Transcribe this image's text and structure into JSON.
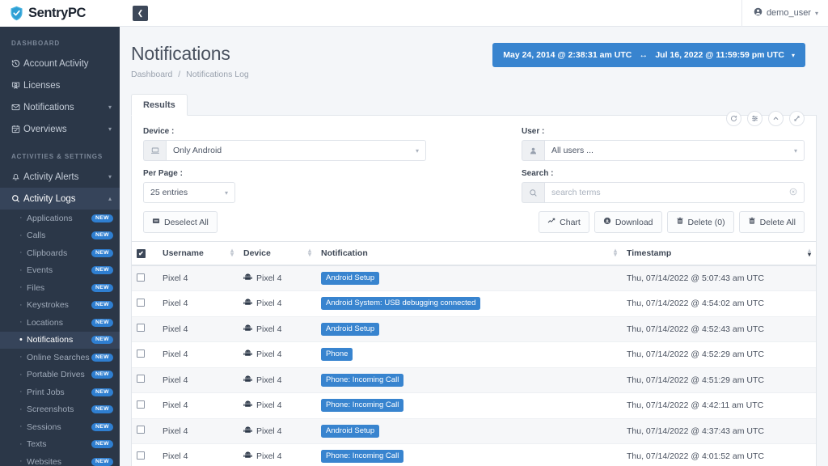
{
  "brand": {
    "name": "SentryPC",
    "logo_icon": "shield-check-icon"
  },
  "topbar": {
    "collapse_icon": "chevron-left-icon",
    "user_icon": "user-circle-icon",
    "username": "demo_user",
    "caret_icon": "chevron-down-icon"
  },
  "sidebar": {
    "sections": [
      {
        "label": "DASHBOARD",
        "items": [
          {
            "label": "Account Activity",
            "icon": "history-icon",
            "caret": false
          },
          {
            "label": "Licenses",
            "icon": "certificate-icon",
            "caret": false
          },
          {
            "label": "Notifications",
            "icon": "envelope-icon",
            "caret": true
          },
          {
            "label": "Overviews",
            "icon": "calendar-check-icon",
            "caret": true
          }
        ]
      },
      {
        "label": "ACTIVITIES & SETTINGS",
        "items": [
          {
            "label": "Activity Alerts",
            "icon": "bell-icon",
            "caret": true,
            "caret_dir": "down",
            "active": false
          },
          {
            "label": "Activity Logs",
            "icon": "search-icon",
            "caret": true,
            "caret_dir": "up",
            "active": true
          }
        ]
      }
    ],
    "sub_items": [
      {
        "label": "Applications",
        "badge": "NEW",
        "active": false
      },
      {
        "label": "Calls",
        "badge": "NEW",
        "active": false
      },
      {
        "label": "Clipboards",
        "badge": "NEW",
        "active": false
      },
      {
        "label": "Events",
        "badge": "NEW",
        "active": false
      },
      {
        "label": "Files",
        "badge": "NEW",
        "active": false
      },
      {
        "label": "Keystrokes",
        "badge": "NEW",
        "active": false
      },
      {
        "label": "Locations",
        "badge": "NEW",
        "active": false
      },
      {
        "label": "Notifications",
        "badge": "NEW",
        "active": true
      },
      {
        "label": "Online Searches",
        "badge": "NEW",
        "active": false
      },
      {
        "label": "Portable Drives",
        "badge": "NEW",
        "active": false
      },
      {
        "label": "Print Jobs",
        "badge": "NEW",
        "active": false
      },
      {
        "label": "Screenshots",
        "badge": "NEW",
        "active": false
      },
      {
        "label": "Sessions",
        "badge": "NEW",
        "active": false
      },
      {
        "label": "Texts",
        "badge": "NEW",
        "active": false
      },
      {
        "label": "Websites",
        "badge": "NEW",
        "active": false
      }
    ]
  },
  "page": {
    "title": "Notifications",
    "breadcrumb_root": "Dashboard",
    "breadcrumb_sep": "/",
    "breadcrumb_current": "Notifications Log",
    "date_range": {
      "start": "May 24, 2014 @ 2:38:31 am UTC",
      "arrows": "↔",
      "end": "Jul 16, 2022 @ 11:59:59 pm UTC",
      "caret_icon": "chevron-down-icon"
    }
  },
  "card": {
    "tab_label": "Results",
    "icon_buttons": [
      {
        "name": "refresh-icon",
        "glyph": "⟳"
      },
      {
        "name": "filter-sliders-icon",
        "glyph": "≡"
      },
      {
        "name": "collapse-chevron-up-icon",
        "glyph": "⌃"
      },
      {
        "name": "expand-fullscreen-icon",
        "glyph": "⤢"
      }
    ]
  },
  "filters": {
    "device_label": "Device :",
    "device_value": "Only Android",
    "device_icon": "laptop-icon",
    "per_page_label": "Per Page :",
    "per_page_value": "25 entries",
    "deselect_label": "Deselect All",
    "deselect_icon": "minus-square-icon",
    "user_label": "User :",
    "user_value": "All users ...",
    "user_icon": "user-icon",
    "search_label": "Search :",
    "search_value": "",
    "search_placeholder": "search terms",
    "search_icon": "magnifier-icon",
    "search_clear_icon": "circle-x-icon",
    "buttons": [
      {
        "label": "Chart",
        "icon": "chart-line-icon"
      },
      {
        "label": "Download",
        "icon": "download-circle-icon"
      },
      {
        "label": "Delete (0)",
        "icon": "trash-icon"
      },
      {
        "label": "Delete All",
        "icon": "trash-icon"
      }
    ]
  },
  "table": {
    "select_all_checked": true,
    "columns": [
      {
        "key": "username",
        "label": "Username",
        "sortable": true,
        "sort": "none"
      },
      {
        "key": "device",
        "label": "Device",
        "sortable": true,
        "sort": "none"
      },
      {
        "key": "notification",
        "label": "Notification",
        "sortable": true,
        "sort": "none"
      },
      {
        "key": "timestamp",
        "label": "Timestamp",
        "sortable": true,
        "sort": "desc"
      }
    ],
    "rows": [
      {
        "checked": false,
        "username": "Pixel 4",
        "device": "Pixel 4",
        "notification": "Android Setup",
        "timestamp": "Thu, 07/14/2022 @ 5:07:43 am UTC"
      },
      {
        "checked": false,
        "username": "Pixel 4",
        "device": "Pixel 4",
        "notification": "Android System: USB debugging connected",
        "timestamp": "Thu, 07/14/2022 @ 4:54:02 am UTC"
      },
      {
        "checked": false,
        "username": "Pixel 4",
        "device": "Pixel 4",
        "notification": "Android Setup",
        "timestamp": "Thu, 07/14/2022 @ 4:52:43 am UTC"
      },
      {
        "checked": false,
        "username": "Pixel 4",
        "device": "Pixel 4",
        "notification": "Phone",
        "timestamp": "Thu, 07/14/2022 @ 4:52:29 am UTC"
      },
      {
        "checked": false,
        "username": "Pixel 4",
        "device": "Pixel 4",
        "notification": "Phone: Incoming Call",
        "timestamp": "Thu, 07/14/2022 @ 4:51:29 am UTC"
      },
      {
        "checked": false,
        "username": "Pixel 4",
        "device": "Pixel 4",
        "notification": "Phone: Incoming Call",
        "timestamp": "Thu, 07/14/2022 @ 4:42:11 am UTC"
      },
      {
        "checked": false,
        "username": "Pixel 4",
        "device": "Pixel 4",
        "notification": "Android Setup",
        "timestamp": "Thu, 07/14/2022 @ 4:37:43 am UTC"
      },
      {
        "checked": false,
        "username": "Pixel 4",
        "device": "Pixel 4",
        "notification": "Phone: Incoming Call",
        "timestamp": "Thu, 07/14/2022 @ 4:01:52 am UTC"
      }
    ],
    "device_icon": "android-robot-icon"
  },
  "colors": {
    "sidebar_bg": "#2b3748",
    "sidebar_active": "#36445a",
    "accent_blue": "#3884cf",
    "badge_blue": "#2f7fd1",
    "page_bg": "#f4f6f9"
  }
}
